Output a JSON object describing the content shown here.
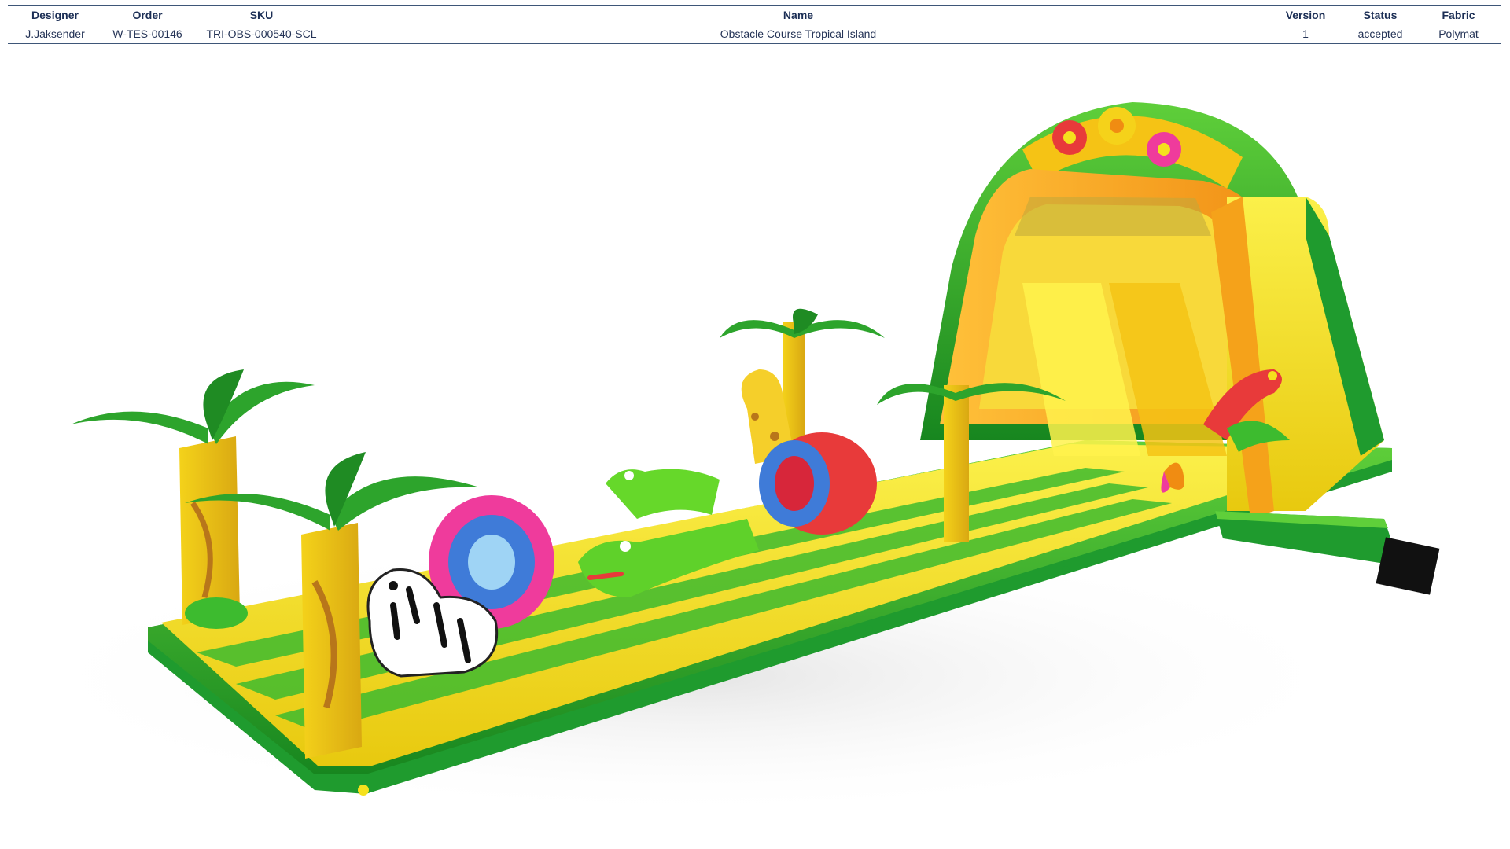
{
  "spec_table": {
    "headers": [
      "Designer",
      "Order",
      "SKU",
      "Name",
      "Version",
      "Status",
      "Fabric"
    ],
    "row": [
      "J.Jaksender",
      "W-TES-00146",
      "TRI-OBS-000540-SCL",
      "Obstacle Course Tropical Island",
      "1",
      "accepted",
      "Polymat"
    ]
  },
  "colors": {
    "green_dark": "#1f9b2e",
    "green_light": "#7fd62c",
    "yellow": "#f5e11d",
    "orange": "#f5a21a",
    "pink": "#ef3b9c",
    "blue": "#3f7bd8",
    "red": "#e83a3a",
    "blower": "#111111"
  }
}
